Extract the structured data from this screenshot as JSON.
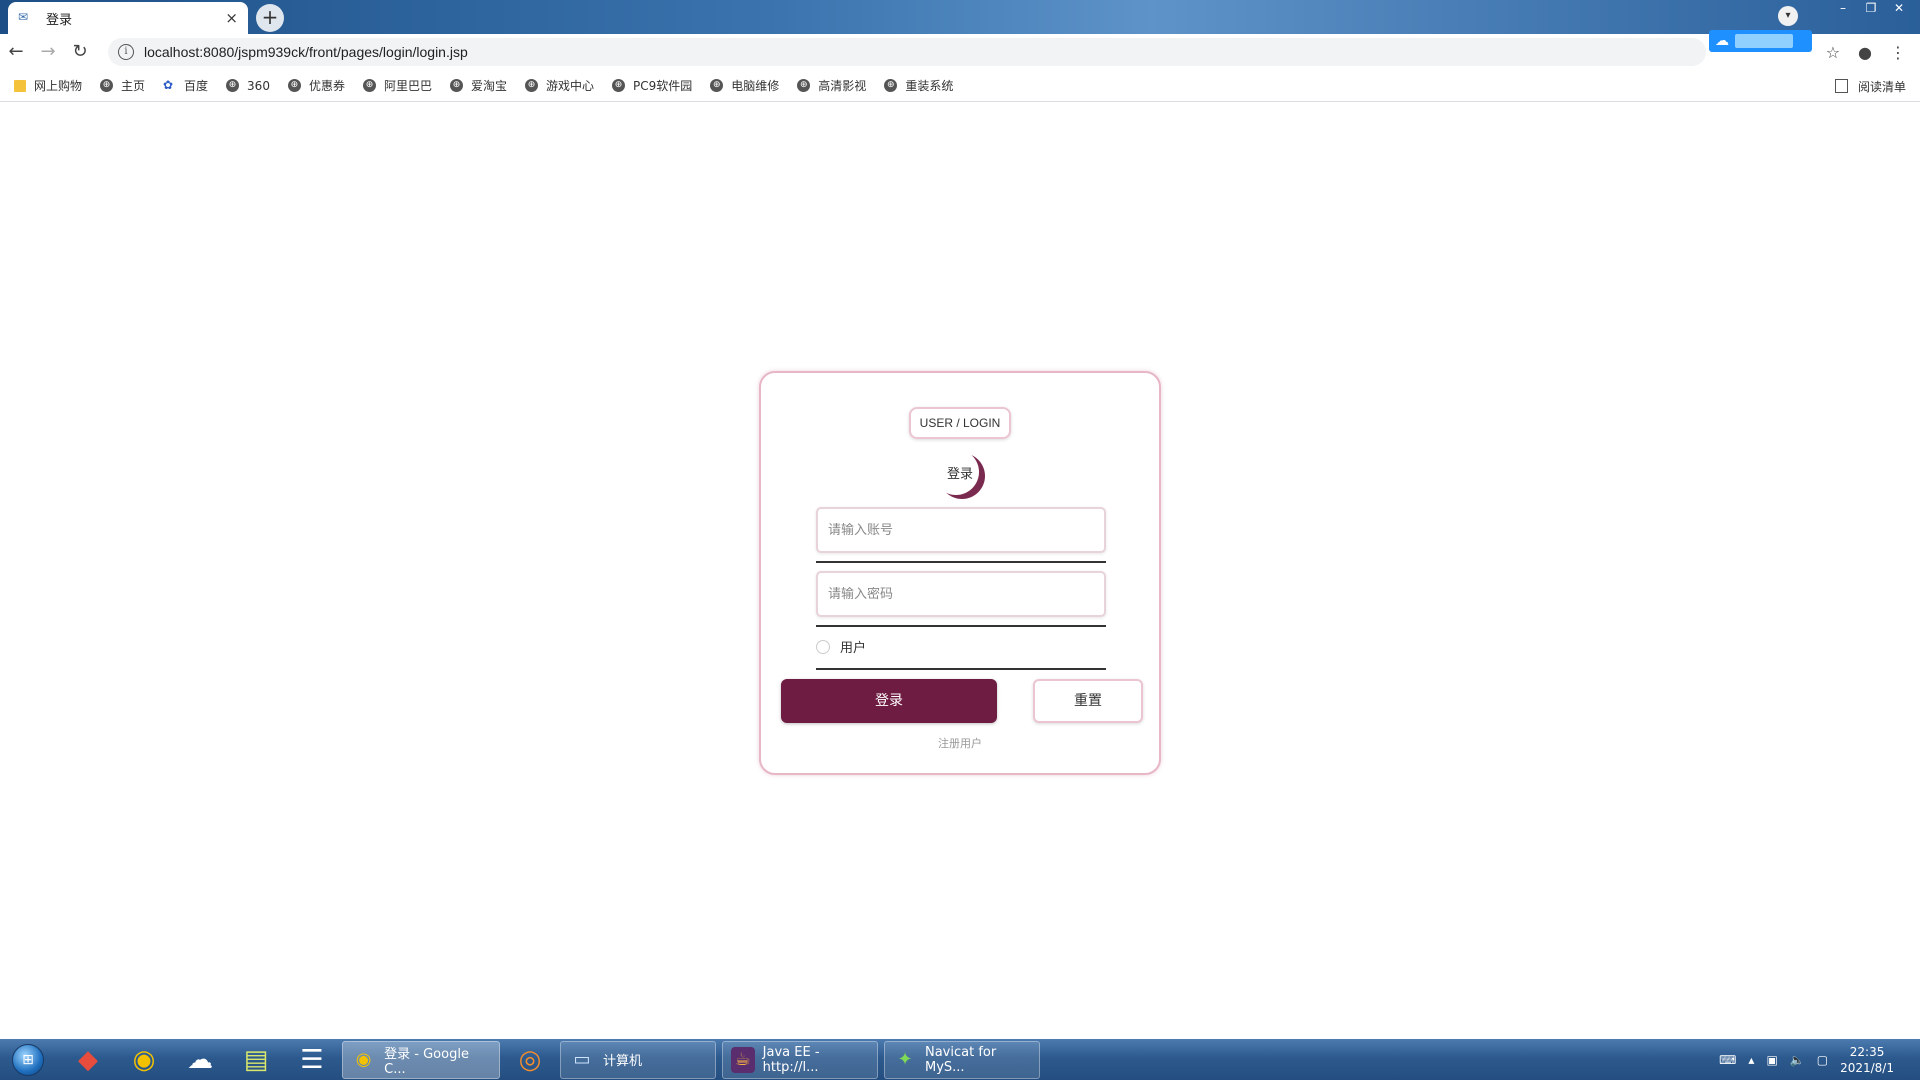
{
  "browser": {
    "tab_title": "登录",
    "tab_close": "×",
    "new_tab": "+",
    "url": "localhost:8080/jspm939ck/front/pages/login/login.jsp",
    "window_controls": [
      "–",
      "❐",
      "✕"
    ],
    "bookmarks": [
      {
        "label": "网上购物",
        "icon": "folder-icon"
      },
      {
        "label": "主页",
        "icon": "globe-icon"
      },
      {
        "label": "百度",
        "icon": "baidu-paw-icon"
      },
      {
        "label": "360",
        "icon": "globe-icon"
      },
      {
        "label": "优惠券",
        "icon": "globe-icon"
      },
      {
        "label": "阿里巴巴",
        "icon": "globe-icon"
      },
      {
        "label": "爱淘宝",
        "icon": "globe-icon"
      },
      {
        "label": "游戏中心",
        "icon": "globe-icon"
      },
      {
        "label": "PC9软件园",
        "icon": "globe-icon"
      },
      {
        "label": "电脑维修",
        "icon": "globe-icon"
      },
      {
        "label": "高清影视",
        "icon": "globe-icon"
      },
      {
        "label": "重装系统",
        "icon": "globe-icon"
      }
    ],
    "reading_list": "阅读清单"
  },
  "login": {
    "tag": "USER / LOGIN",
    "title": "登录",
    "account_placeholder": "请输入账号",
    "password_placeholder": "请输入密码",
    "role_label": "用户",
    "login_button": "登录",
    "reset_button": "重置",
    "register_link": "注册用户",
    "accent_color": "#6f1c43",
    "border_color": "#e7b7c6"
  },
  "taskbar": {
    "tasks": [
      {
        "label": "登录 - Google C...",
        "icon": "chrome-icon",
        "active": true
      },
      {
        "label": "计算机",
        "icon": "computer-icon",
        "active": false
      },
      {
        "label": "Java EE - http://l...",
        "icon": "eclipse-icon",
        "active": false
      },
      {
        "label": "Navicat for MyS...",
        "icon": "navicat-icon",
        "active": false
      }
    ],
    "time": "22:35",
    "date": "2021/8/1"
  }
}
